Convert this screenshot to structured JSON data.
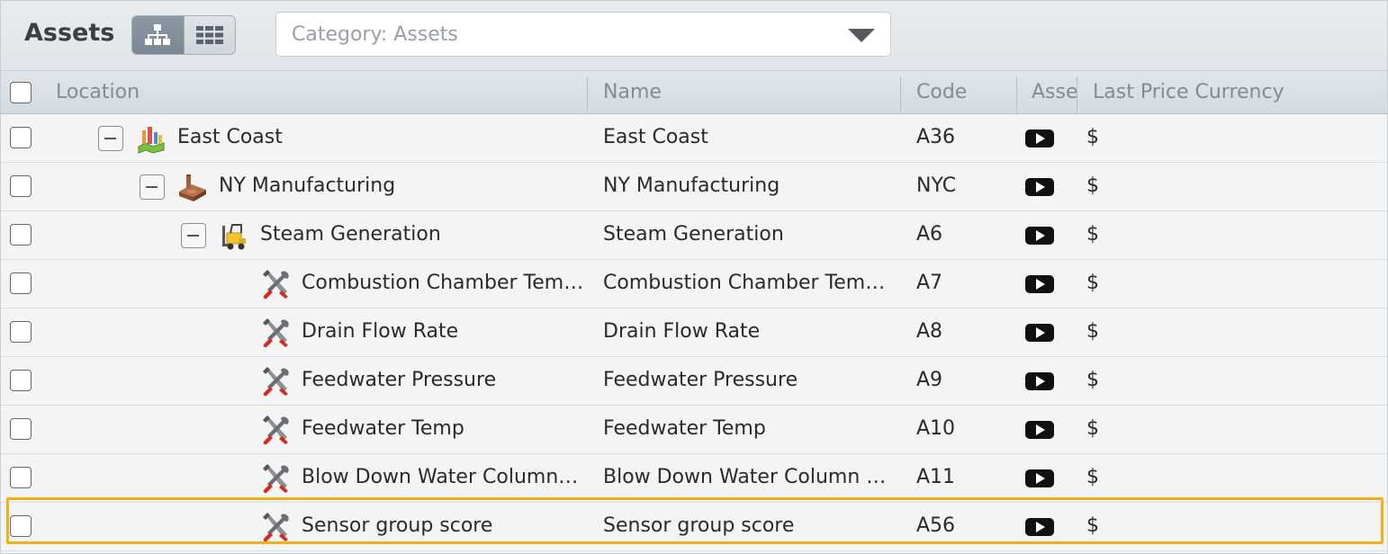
{
  "toolbar": {
    "title": "Assets",
    "view_modes": [
      {
        "name": "tree-view",
        "active": true
      },
      {
        "name": "grid-view",
        "active": false
      }
    ],
    "category_filter": "Category: Assets"
  },
  "table": {
    "columns": [
      "Location",
      "Name",
      "Code",
      "Asset",
      "Last Price Currency"
    ],
    "rows": [
      {
        "location": "East Coast",
        "name": "East Coast",
        "code": "A36",
        "currency": "$",
        "icon": "region-map-icon",
        "collapsible": true
      },
      {
        "location": "NY Manufacturing",
        "name": "NY Manufacturing",
        "code": "NYC",
        "currency": "$",
        "icon": "factory-icon",
        "collapsible": true
      },
      {
        "location": "Steam Generation",
        "name": "Steam Generation",
        "code": "A6",
        "currency": "$",
        "icon": "forklift-icon",
        "collapsible": true
      },
      {
        "location": "Combustion Chamber Temperature",
        "name": "Combustion Chamber Temperature",
        "code": "A7",
        "currency": "$",
        "icon": "tools-icon",
        "collapsible": false
      },
      {
        "location": "Drain Flow Rate",
        "name": "Drain Flow Rate",
        "code": "A8",
        "currency": "$",
        "icon": "tools-icon",
        "collapsible": false
      },
      {
        "location": "Feedwater Pressure",
        "name": "Feedwater Pressure",
        "code": "A9",
        "currency": "$",
        "icon": "tools-icon",
        "collapsible": false
      },
      {
        "location": "Feedwater Temp",
        "name": "Feedwater Temp",
        "code": "A10",
        "currency": "$",
        "icon": "tools-icon",
        "collapsible": false
      },
      {
        "location": "Blow Down Water Column Level",
        "name": "Blow Down Water Column Level",
        "code": "A11",
        "currency": "$",
        "icon": "tools-icon",
        "collapsible": false
      },
      {
        "location": "Sensor group score",
        "name": "Sensor group score",
        "code": "A56",
        "currency": "$",
        "icon": "tools-icon",
        "collapsible": false,
        "selected": true
      }
    ]
  },
  "colors": {
    "selection_outline": "#f2b217",
    "tools_handle": "#d22b1f"
  }
}
